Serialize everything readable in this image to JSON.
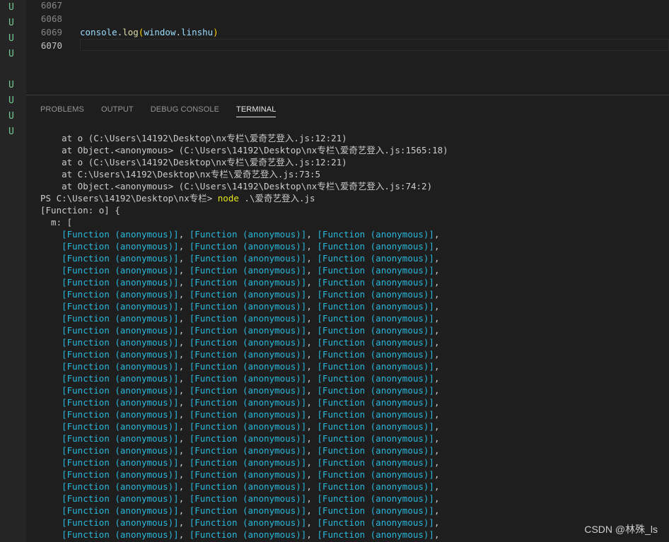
{
  "colors": {
    "background": "#1e1e1e",
    "gutter": "#252526",
    "git_untracked": "#73c991",
    "terminal_text": "#cccccc",
    "function_cyan": "#29b8db",
    "command_yellow": "#e5e510"
  },
  "git_gutter": {
    "markers": [
      "U",
      "U",
      "U",
      "U",
      "U",
      "U",
      "U",
      "U"
    ]
  },
  "editor": {
    "line_numbers": [
      "6067",
      "6068",
      "6069",
      "6070"
    ],
    "code": {
      "obj": "console",
      "dot1": ".",
      "method": "log",
      "open_paren": "(",
      "arg_obj": "window",
      "dot2": ".",
      "arg_prop": "linshu",
      "close_paren": ")"
    }
  },
  "panel": {
    "tabs": [
      "PROBLEMS",
      "OUTPUT",
      "DEBUG CONSOLE",
      "TERMINAL"
    ],
    "active_tab": "TERMINAL"
  },
  "terminal": {
    "stack": [
      "    at o (C:\\Users\\14192\\Desktop\\nx专栏\\爱奇艺登入.js:12:21)",
      "    at Object.<anonymous> (C:\\Users\\14192\\Desktop\\nx专栏\\爱奇艺登入.js:1565:18)",
      "    at o (C:\\Users\\14192\\Desktop\\nx专栏\\爱奇艺登入.js:12:21)",
      "    at C:\\Users\\14192\\Desktop\\nx专栏\\爱奇艺登入.js:73:5",
      "    at Object.<anonymous> (C:\\Users\\14192\\Desktop\\nx专栏\\爱奇艺登入.js:74:2)"
    ],
    "prompt": "PS C:\\Users\\14192\\Desktop\\nx专栏> ",
    "command": "node",
    "command_args": " .\\爱奇艺登入.js",
    "output_head": "[Function: o] {",
    "output_key": "  m: [",
    "indent": "    ",
    "function_item": "[Function (anonymous)]",
    "separator": ", ",
    "line_end": ",",
    "function_rows": 26,
    "items_per_row": 3
  },
  "watermark": "CSDN @林殊_ls"
}
